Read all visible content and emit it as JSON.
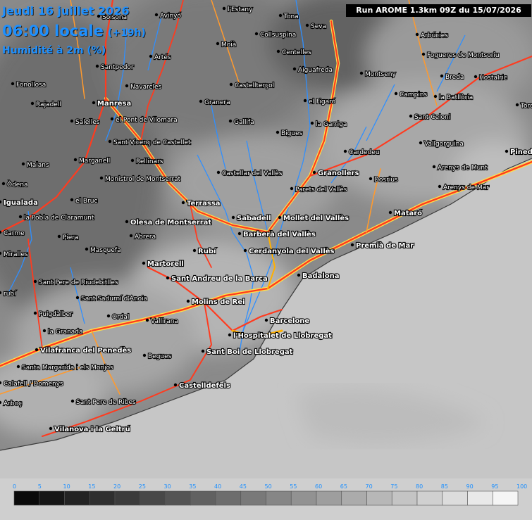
{
  "header": {
    "date_line": "Jeudi 16 juillet 2026",
    "time_line": "06:00 locale",
    "offset": "(+19h)",
    "parameter": "Humidité à 2m (%)",
    "run_label": "Run AROME 1.3km 09Z du 15/07/2026"
  },
  "colors": {
    "title_text": "#1e90ff",
    "road_major": "#ff3b1f",
    "road_secondary": "#ff9a2e",
    "road_casing": "#ffe14a",
    "river": "#2f8fff",
    "coast": "#3a3a3a",
    "sea": "#c8c8c8"
  },
  "places": [
    {
      "name": "Jeudi",
      "hidden": true
    },
    {
      "name": "Solsona"
    },
    {
      "name": "Avinyó"
    },
    {
      "name": "l'Estany"
    },
    {
      "name": "Tona"
    },
    {
      "name": "Seva"
    },
    {
      "name": "Arbúcies"
    },
    {
      "name": "Collsuspina"
    },
    {
      "name": "Moià"
    },
    {
      "name": "Centelles"
    },
    {
      "name": "Fogueres de Montsoriu"
    },
    {
      "name": "Artés"
    },
    {
      "name": "Santpedor"
    },
    {
      "name": "Aiguafreda"
    },
    {
      "name": "Montseny"
    },
    {
      "name": "Breda"
    },
    {
      "name": "Hostalric"
    },
    {
      "name": "Fonollosa"
    },
    {
      "name": "Navarcles"
    },
    {
      "name": "Castellterçol"
    },
    {
      "name": "Campins"
    },
    {
      "name": "la Batllòria"
    },
    {
      "name": "Rajadell"
    },
    {
      "name": "Manresa"
    },
    {
      "name": "Granera"
    },
    {
      "name": "el Figaró"
    },
    {
      "name": "Salelles"
    },
    {
      "name": "el Pont de Vilomara"
    },
    {
      "name": "Gallifa"
    },
    {
      "name": "la Garriga"
    },
    {
      "name": "Sant Celoni"
    },
    {
      "name": "Sant Vicenç de Castellet"
    },
    {
      "name": "Bigues"
    },
    {
      "name": "Vallgorguina"
    },
    {
      "name": "Cardedeu"
    },
    {
      "name": "Marganell"
    },
    {
      "name": "Maians"
    },
    {
      "name": "Rellinars"
    },
    {
      "name": "Arenys de Munt"
    },
    {
      "name": "Castellar del Vallès"
    },
    {
      "name": "Granollers"
    },
    {
      "name": "Monistrol de Montserrat"
    },
    {
      "name": "Dosrius"
    },
    {
      "name": "Òdena"
    },
    {
      "name": "Parets del Vallès"
    },
    {
      "name": "Arenys de Mar"
    },
    {
      "name": "Igualada"
    },
    {
      "name": "el Bruc"
    },
    {
      "name": "Terrassa"
    },
    {
      "name": "Mataró"
    },
    {
      "name": "la Pobla de Claramunt"
    },
    {
      "name": "Sabadell"
    },
    {
      "name": "Mollet del Vallès"
    },
    {
      "name": "Olesa de Montserrat"
    },
    {
      "name": "Carme"
    },
    {
      "name": "Piera"
    },
    {
      "name": "Abrera"
    },
    {
      "name": "Barberà del Vallès"
    },
    {
      "name": "Premià de Mar"
    },
    {
      "name": "Masquefa"
    },
    {
      "name": "Rubí"
    },
    {
      "name": "Cerdanyola del Vallès"
    },
    {
      "name": "Miralles"
    },
    {
      "name": "Martorell"
    },
    {
      "name": "Badalona"
    },
    {
      "name": "Sant Andreu de la Barca"
    },
    {
      "name": "Sant Pere de Riudebitlles"
    },
    {
      "name": "Sant Sadurní d'Anoia"
    },
    {
      "name": "Molins de Rei"
    },
    {
      "name": "Puigdàlber"
    },
    {
      "name": "Ordal"
    },
    {
      "name": "Barcelone"
    },
    {
      "name": "Vallirana"
    },
    {
      "name": "la Granada"
    },
    {
      "name": "l'Hospitalet de Llobregat"
    },
    {
      "name": "Vilafranca del Penedès"
    },
    {
      "name": "Sant Boi de Llobregat"
    },
    {
      "name": "Begues"
    },
    {
      "name": "Santa Margarida i els Monjos"
    },
    {
      "name": "Castelldefels"
    },
    {
      "name": "Sant Pere de Ribes"
    },
    {
      "name": "Vilanova i la Geltrú"
    },
    {
      "name": "Pineda"
    },
    {
      "name": "Tordera"
    },
    {
      "name": "rubí"
    },
    {
      "name": "Arboç"
    },
    {
      "name": "Calafell / Domenys"
    }
  ],
  "legend": {
    "ticks": [
      "0",
      "5",
      "10",
      "15",
      "20",
      "25",
      "30",
      "35",
      "40",
      "45",
      "50",
      "55",
      "60",
      "65",
      "70",
      "75",
      "80",
      "85",
      "90",
      "95",
      "100"
    ],
    "steps": 20
  }
}
